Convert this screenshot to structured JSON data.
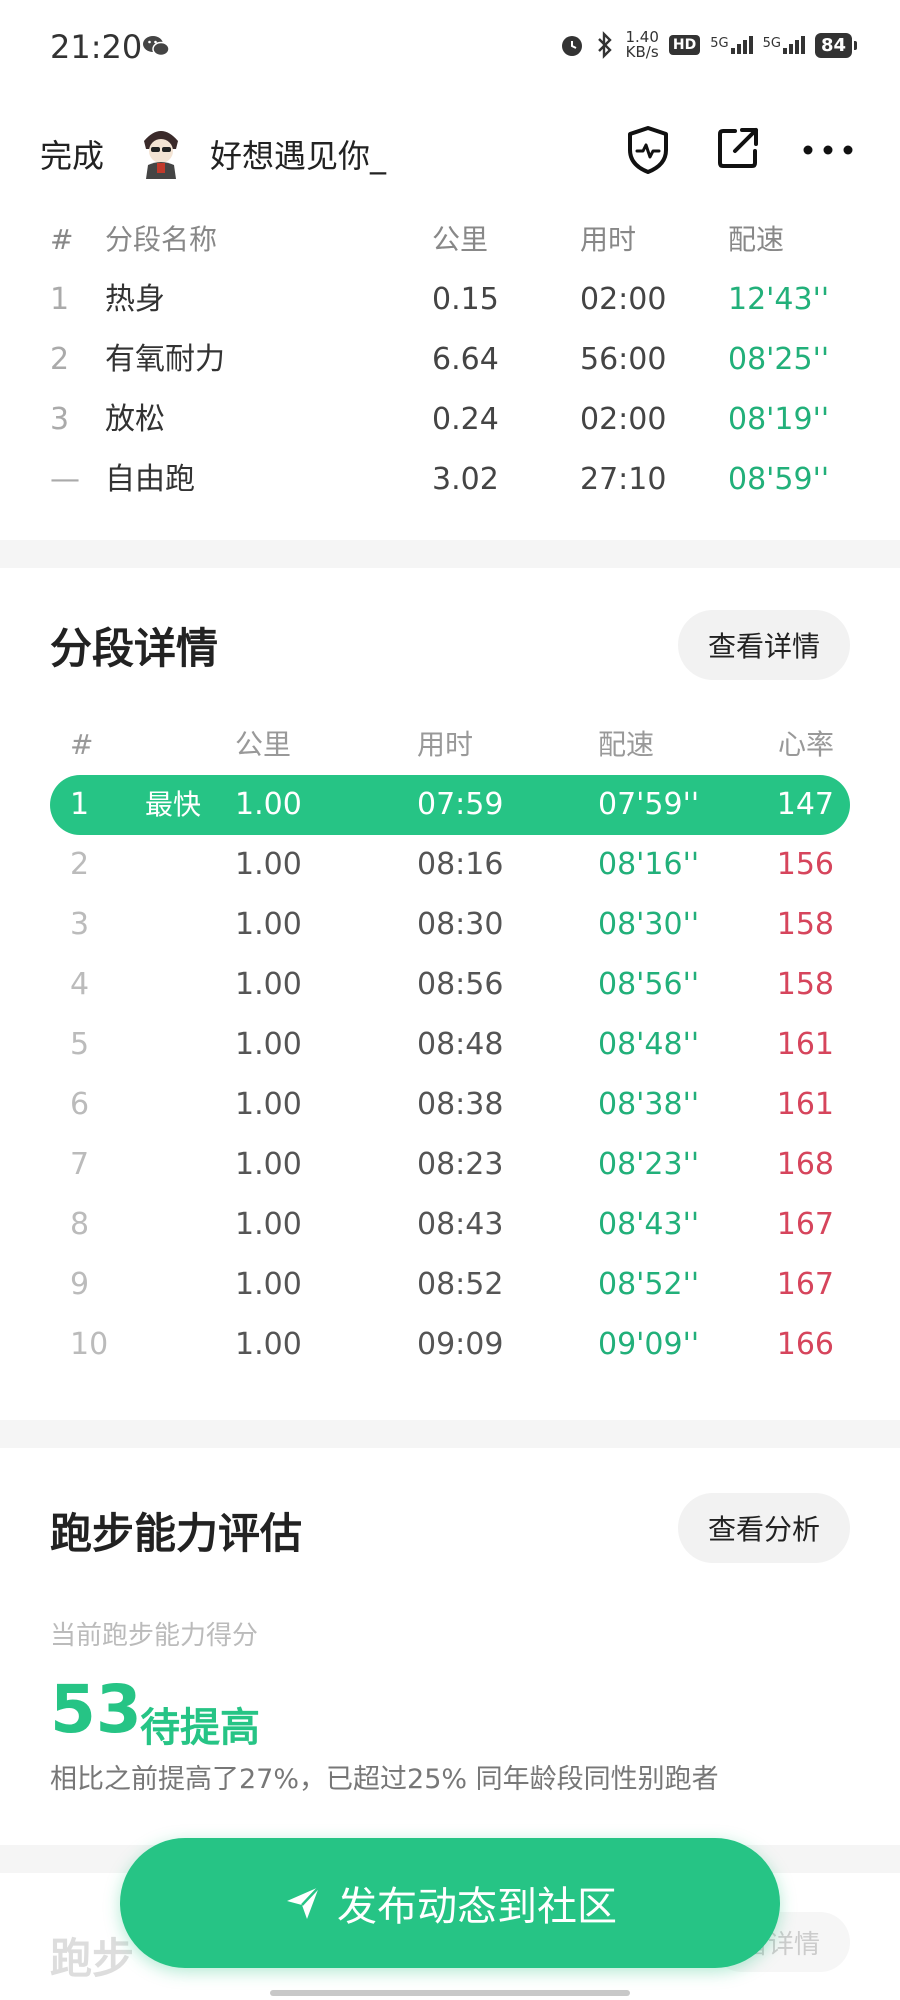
{
  "status_bar": {
    "time": "21:20",
    "net_speed_value": "1.40",
    "net_speed_unit": "KB/s",
    "hd_label": "HD",
    "sim1_label": "5G",
    "sim2_label": "5G",
    "battery": "84",
    "icons": [
      "wechat-icon",
      "alarm-icon",
      "bluetooth-icon",
      "hd-icon",
      "signal-icon",
      "battery-icon"
    ]
  },
  "topbar": {
    "done_label": "完成",
    "username": "好想遇见你_",
    "icons": [
      "avatar",
      "shield-icon",
      "share-icon",
      "more-icon"
    ]
  },
  "segments": {
    "headers": {
      "idx": "#",
      "name": "分段名称",
      "km": "公里",
      "time": "用时",
      "pace": "配速"
    },
    "rows": [
      {
        "idx": "1",
        "name": "热身",
        "km": "0.15",
        "time": "02:00",
        "pace": "12'43''"
      },
      {
        "idx": "2",
        "name": "有氧耐力",
        "km": "6.64",
        "time": "56:00",
        "pace": "08'25''"
      },
      {
        "idx": "3",
        "name": "放松",
        "km": "0.24",
        "time": "02:00",
        "pace": "08'19''"
      },
      {
        "idx": "—",
        "name": "自由跑",
        "km": "3.02",
        "time": "27:10",
        "pace": "08'59''"
      }
    ]
  },
  "details": {
    "title": "分段详情",
    "button": "查看详情",
    "headers": {
      "idx": "#",
      "km": "公里",
      "time": "用时",
      "pace": "配速",
      "hr": "心率"
    },
    "fastest_tag": "最快",
    "rows": [
      {
        "idx": "1",
        "km": "1.00",
        "time": "07:59",
        "pace": "07'59''",
        "hr": "147"
      },
      {
        "idx": "2",
        "km": "1.00",
        "time": "08:16",
        "pace": "08'16''",
        "hr": "156"
      },
      {
        "idx": "3",
        "km": "1.00",
        "time": "08:30",
        "pace": "08'30''",
        "hr": "158"
      },
      {
        "idx": "4",
        "km": "1.00",
        "time": "08:56",
        "pace": "08'56''",
        "hr": "158"
      },
      {
        "idx": "5",
        "km": "1.00",
        "time": "08:48",
        "pace": "08'48''",
        "hr": "161"
      },
      {
        "idx": "6",
        "km": "1.00",
        "time": "08:38",
        "pace": "08'38''",
        "hr": "161"
      },
      {
        "idx": "7",
        "km": "1.00",
        "time": "08:23",
        "pace": "08'23''",
        "hr": "168"
      },
      {
        "idx": "8",
        "km": "1.00",
        "time": "08:43",
        "pace": "08'43''",
        "hr": "167"
      },
      {
        "idx": "9",
        "km": "1.00",
        "time": "08:52",
        "pace": "08'52''",
        "hr": "167"
      },
      {
        "idx": "10",
        "km": "1.00",
        "time": "09:09",
        "pace": "09'09''",
        "hr": "166"
      }
    ]
  },
  "ability": {
    "title": "跑步能力评估",
    "button": "查看分析",
    "subtitle": "当前跑步能力得分",
    "score": "53",
    "level": "待提高",
    "description": "相比之前提高了27%，已超过25% 同年龄段同性别跑者"
  },
  "next_section": {
    "title_partial": "跑步",
    "button_partial": "看详情"
  },
  "publish_button": "发布动态到社区",
  "colors": {
    "accent": "#26c485",
    "pace_green": "#22b07a",
    "heart_rate_red": "#d6455c",
    "divider": "#f5f5f5"
  }
}
